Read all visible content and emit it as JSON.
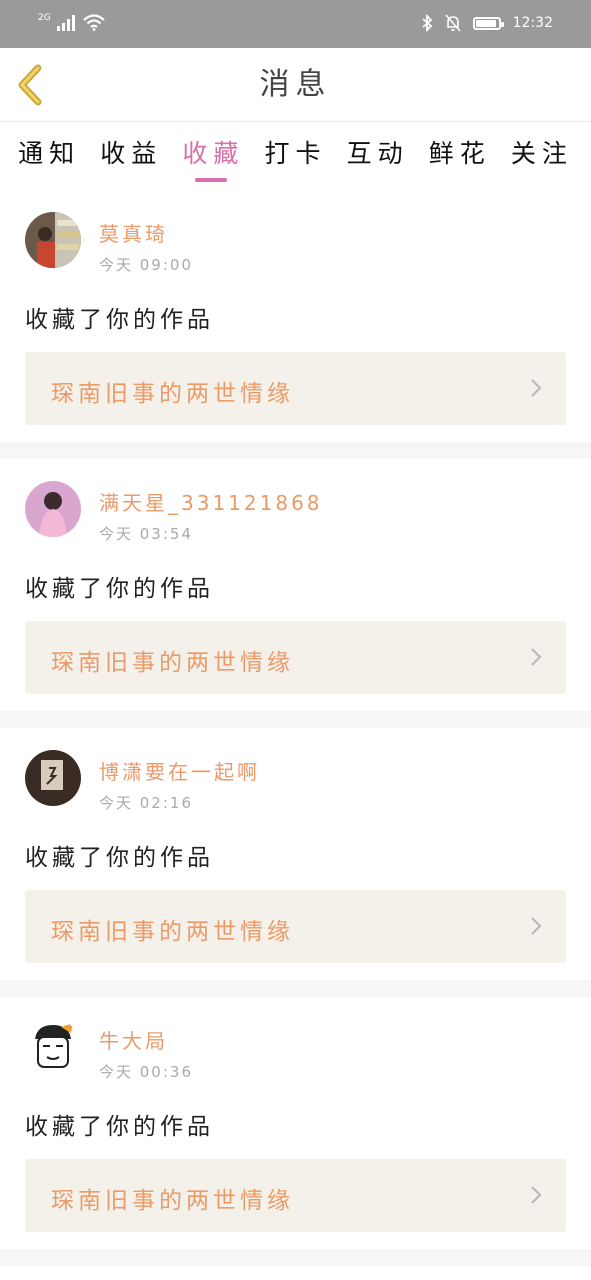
{
  "status_bar": {
    "network": "2G",
    "time": "12:32",
    "battery_level": 0.9
  },
  "header": {
    "title": "消息",
    "back_icon": "chevron-left-icon"
  },
  "tabs": [
    {
      "label": "通知",
      "active": false
    },
    {
      "label": "收益",
      "active": false
    },
    {
      "label": "收藏",
      "active": true
    },
    {
      "label": "打卡",
      "active": false
    },
    {
      "label": "互动",
      "active": false
    },
    {
      "label": "鲜花",
      "active": false
    },
    {
      "label": "关注",
      "active": false
    }
  ],
  "colors": {
    "accent": "#d96fa8",
    "name": "#ec9a68",
    "work_bg": "#f3f1ea"
  },
  "messages": [
    {
      "name": "莫真琦",
      "time": "今天 09:00",
      "action": "收藏了你的作品",
      "work": "琛南旧事的两世情缘"
    },
    {
      "name": "满天星_331121868",
      "time": "今天 03:54",
      "action": "收藏了你的作品",
      "work": "琛南旧事的两世情缘"
    },
    {
      "name": "博潇要在一起啊",
      "time": "今天 02:16",
      "action": "收藏了你的作品",
      "work": "琛南旧事的两世情缘"
    },
    {
      "name": "牛大局",
      "time": "今天 00:36",
      "action": "收藏了你的作品",
      "work": "琛南旧事的两世情缘"
    }
  ]
}
